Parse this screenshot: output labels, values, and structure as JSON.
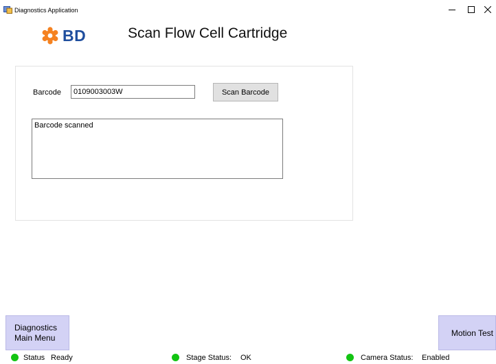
{
  "window": {
    "title": "Diagnostics Application",
    "icon": "app-icon"
  },
  "brand": {
    "text": "BD",
    "color": "#1f4e9e",
    "mark_color": "#f58220",
    "icon": "bd-logo-icon"
  },
  "page": {
    "title": "Scan Flow Cell Cartridge"
  },
  "form": {
    "barcode_label": "Barcode",
    "barcode_value": "0109003003W",
    "scan_button": "Scan Barcode",
    "log_text": "Barcode scanned"
  },
  "nav": {
    "main_menu_line1": "Diagnostics",
    "main_menu_line2": "Main Menu",
    "motion_test": "Motion Test",
    "button_color": "#d3d2f5"
  },
  "status": {
    "indicator_color": "#13c413",
    "status_label": "Status",
    "status_value": "Ready",
    "stage_label": "Stage Status:",
    "stage_value": "OK",
    "camera_label": "Camera Status:",
    "camera_value": "Enabled"
  }
}
